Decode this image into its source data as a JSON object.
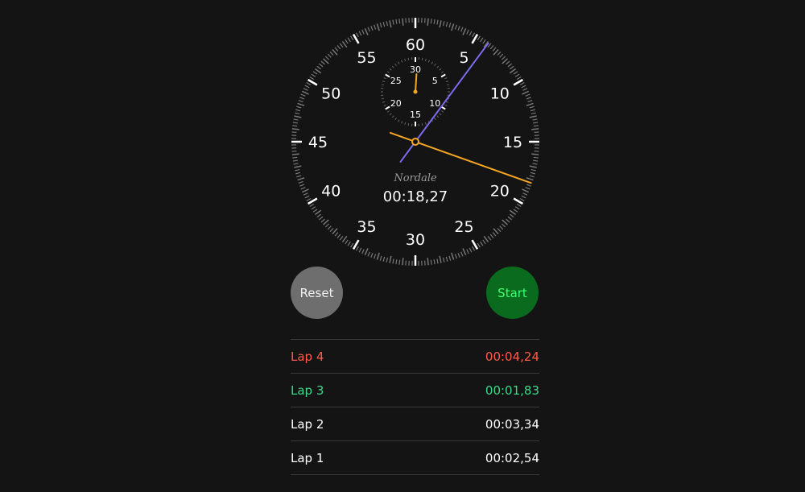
{
  "watch": {
    "brand": "Nordale",
    "digital_time": "00:18,27",
    "elapsed_seconds": 18.27,
    "main_dial_numbers": [
      "60",
      "5",
      "10",
      "15",
      "20",
      "25",
      "30",
      "35",
      "40",
      "45",
      "50",
      "55"
    ],
    "sub_dial_numbers": [
      "30",
      "5",
      "10",
      "15",
      "20",
      "25"
    ],
    "colors": {
      "face": "#141414",
      "tick": "#777777",
      "major_tick": "#ffffff",
      "seconds_hand": "#f5a623",
      "lap_hand": "#7b6cf0",
      "minutes_hand": "#f5a623"
    }
  },
  "controls": {
    "reset_label": "Reset",
    "start_label": "Start",
    "reset_color": "#6e6e6e",
    "start_color": "#0a6b1f",
    "start_text_color": "#3dff70"
  },
  "laps": [
    {
      "label": "Lap 4",
      "time": "00:04,24",
      "status": "slowest"
    },
    {
      "label": "Lap 3",
      "time": "00:01,83",
      "status": "fastest"
    },
    {
      "label": "Lap 2",
      "time": "00:03,34",
      "status": "normal"
    },
    {
      "label": "Lap 1",
      "time": "00:02,54",
      "status": "normal"
    }
  ],
  "lap_colors": {
    "slowest": "#ff5b47",
    "fastest": "#39d98a",
    "normal": "#ffffff"
  }
}
